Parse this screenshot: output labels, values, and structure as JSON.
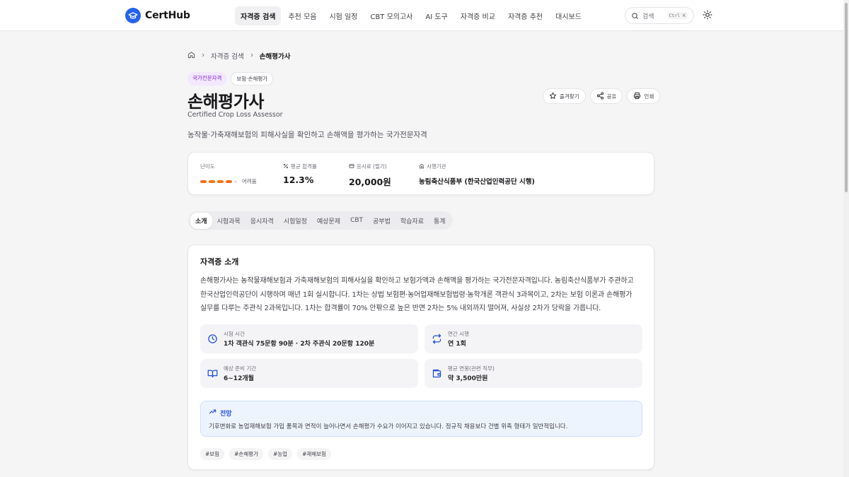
{
  "header": {
    "logo_text": "CertHub",
    "nav": [
      "자격증 검색",
      "추천 모음",
      "시험 일정",
      "CBT 모의고사",
      "AI 도구",
      "자격증 비교",
      "자격증 추천",
      "대시보드"
    ],
    "active_nav": "자격증 검색",
    "search_label": "검색",
    "search_shortcut": "Ctrl K",
    "theme_icon": "sun-icon"
  },
  "breadcrumb": {
    "home_icon": "home-icon",
    "level1": "자격증 검색",
    "current": "손해평가사"
  },
  "cert": {
    "tags": [
      "국가전문자격",
      "보험·손해평가"
    ],
    "title": "손해평가사",
    "title_en": "Certified Crop Loss Assessor",
    "description": "농작물·가축재해보험의 피해사실을 확인하고 손해액을 평가하는 국가전문자격"
  },
  "actions": {
    "favorite": "즐겨찾기",
    "share": "공유",
    "print": "인쇄"
  },
  "stats": {
    "difficulty_label": "난이도",
    "difficulty_level": 4,
    "difficulty_max": 5,
    "difficulty_text": "어려움",
    "pass_rate_label": "평균 합격률",
    "pass_rate": "12.3%",
    "fee_label": "응시료 (필기)",
    "fee": "20,000원",
    "org_label": "시행기관",
    "org": "농림축산식품부 (한국산업인력공단 시행)"
  },
  "tabs": [
    "소개",
    "시험과목",
    "응시자격",
    "시험일정",
    "예상문제",
    "CBT",
    "공부법",
    "학습자료",
    "통계"
  ],
  "active_tab": "소개",
  "intro": {
    "title": "자격증 소개",
    "body": "손해평가사는 농작물재해보험과 가축재해보험의 피해사실을 확인하고 보험가액과 손해액을 평가하는 국가전문자격입니다. 농림축산식품부가 주관하고 한국산업인력공단이 시행하며 매년 1회 실시합니다. 1차는 상법 보험편·농어업재해보험법령·농학개론 객관식 3과목이고, 2차는 보험 이론과 손해평가 실무를 다루는 주관식 2과목입니다. 1차는 합격률이 70% 안팎으로 높은 반면 2차는 5% 내외까지 떨어져, 사실상 2차가 당락을 가릅니다.",
    "info": [
      {
        "icon": "clock-icon",
        "label": "시험 시간",
        "value": "1차 객관식 75문항 90분 · 2차 주관식 20문항 120분"
      },
      {
        "icon": "repeat-icon",
        "label": "연간 시행",
        "value": "연 1회"
      },
      {
        "icon": "book-icon",
        "label": "예상 준비 기간",
        "value": "6~12개월"
      },
      {
        "icon": "wallet-icon",
        "label": "평균 연봉(관련 직무)",
        "value": "약 3,500만원"
      }
    ],
    "outlook_title": "전망",
    "outlook_text": "기후변화로 농업재해보험 가입 품목과 면적이 늘어나면서 손해평가 수요가 이어지고 있습니다. 정규직 채용보다 건별 위촉 형태가 일반적입니다.",
    "hashtags": [
      "#보험",
      "#손해평가",
      "#농업",
      "#재해보험"
    ]
  },
  "colors": {
    "brand": "#2563eb",
    "difficulty": "#f97316",
    "outlook_accent": "#1d4ed8",
    "tag_purple": "#7e22ce"
  }
}
